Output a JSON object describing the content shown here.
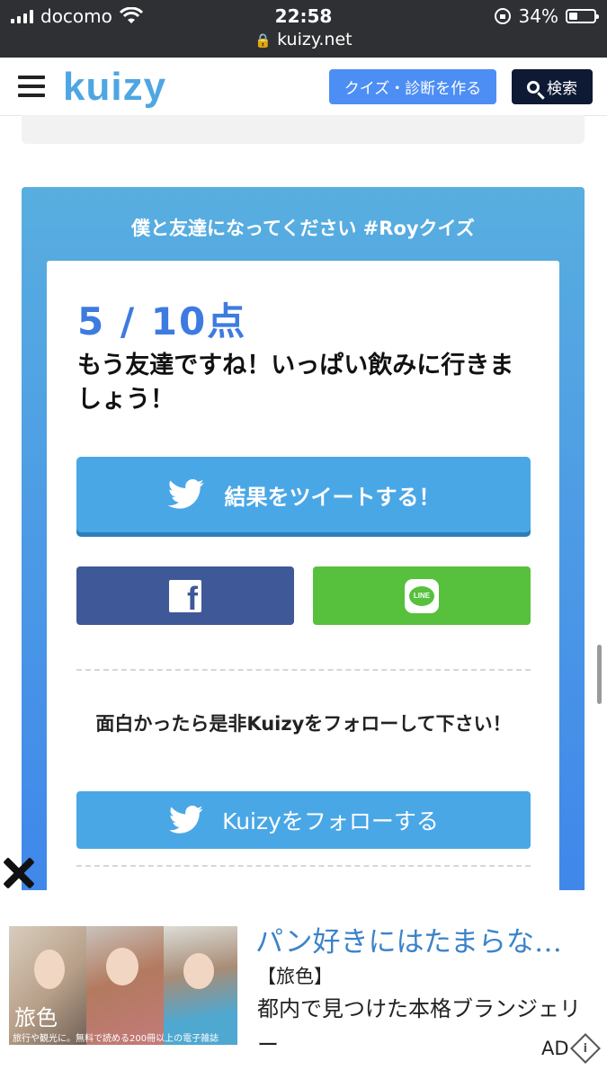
{
  "status_bar": {
    "carrier": "docomo",
    "time": "22:58",
    "url": "kuizy.net",
    "battery": "34%"
  },
  "header": {
    "logo": "kuizy",
    "create_label": "クイズ・診断を作る",
    "search_label": "検索"
  },
  "result": {
    "quiz_title": "僕と友達になってください #Royクイズ",
    "score": "5 / 10点",
    "message": "もう友達ですね！いっぱい飲みに行きましょう！",
    "tweet_label": "結果をツイートする！",
    "follow_prompt": "面白かったら是非Kuizyをフォローして下さい！",
    "follow_label": "Kuizyをフォローする",
    "line_icon_text": "LINE",
    "facebook_icon_text": "f"
  },
  "ad": {
    "headline": "パン好きにはたまらな…",
    "source": "【旅色】",
    "description": "都内で見つけた本格ブランジェリー",
    "image_brand": "旅色",
    "image_caption": "旅行や観光に。無料で読める200冊以上の電子雑誌",
    "label": "AD"
  },
  "colors": {
    "brand_blue": "#4ea6e3",
    "create_button": "#4d8ef5",
    "search_button": "#0e1a34",
    "facebook": "#3f5898",
    "line": "#57c03c",
    "twitter": "#4aa7e6",
    "score": "#3e7be0"
  }
}
